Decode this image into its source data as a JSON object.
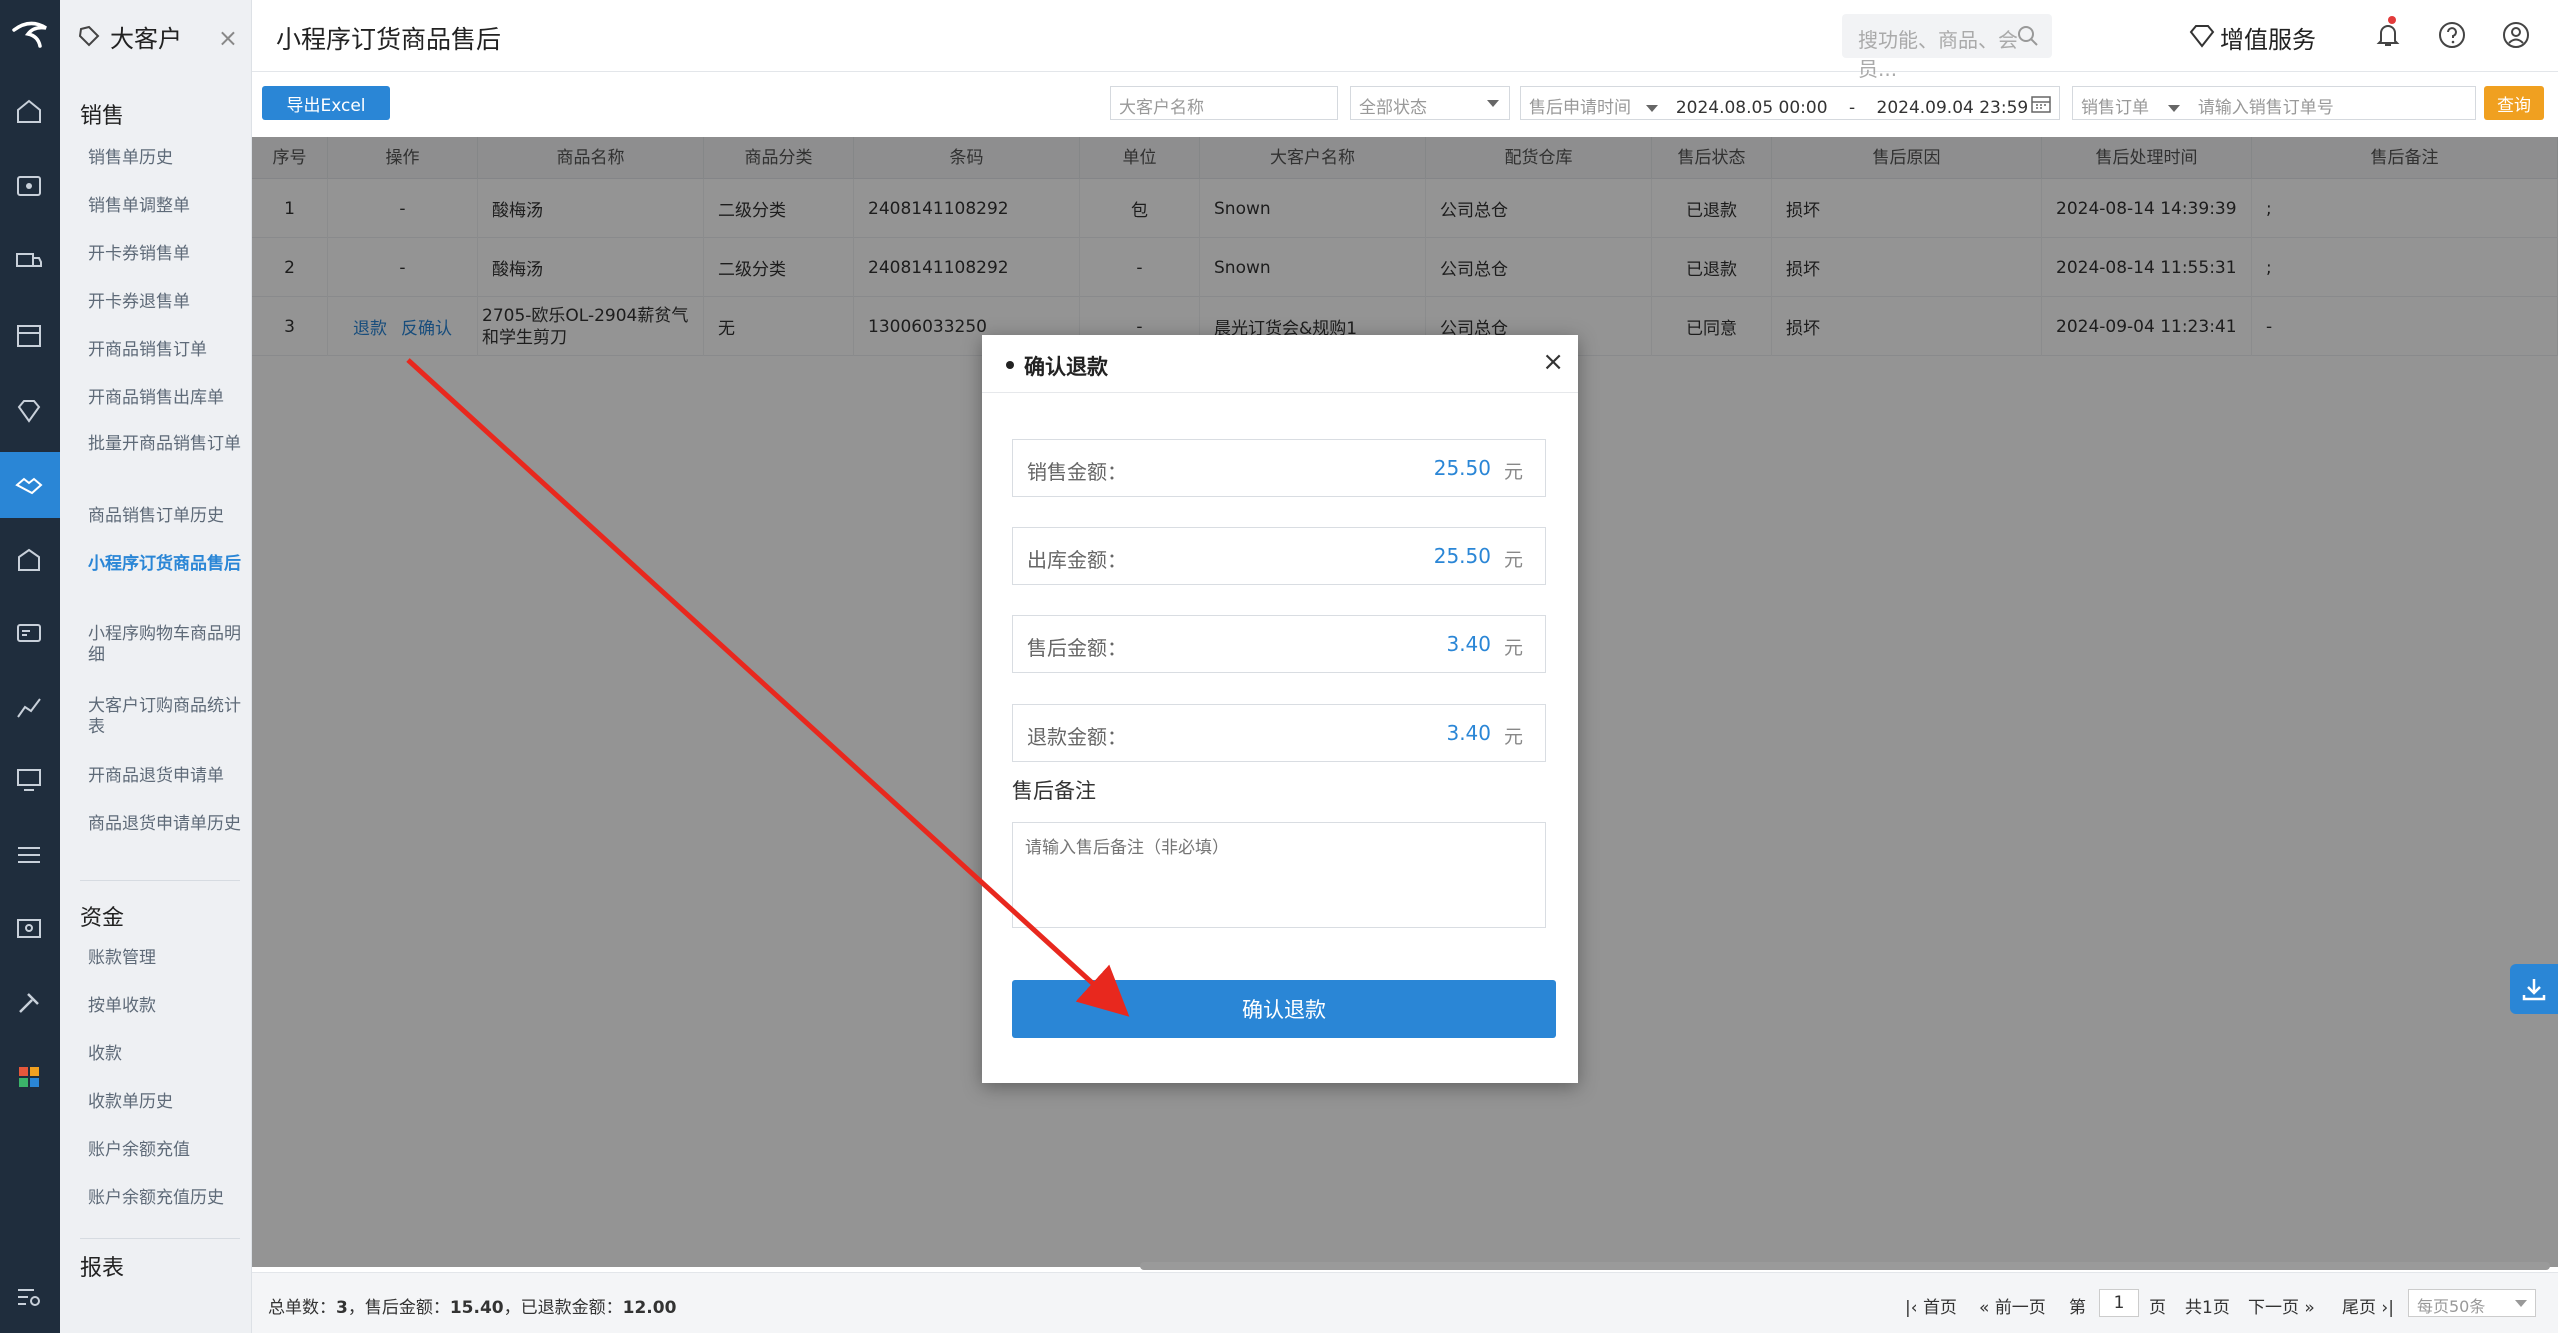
{
  "app": {
    "tab_name": "大客户",
    "page_title": "小程序订货商品售后",
    "search_placeholder": "搜功能、商品、会员...",
    "value_added_service": "增值服务"
  },
  "sidebar": {
    "groups": [
      {
        "label": "销售"
      },
      {
        "label": "资金"
      },
      {
        "label": "报表"
      }
    ],
    "sales_items": [
      {
        "label": "销售单历史"
      },
      {
        "label": "销售单调整单"
      },
      {
        "label": "开卡券销售单"
      },
      {
        "label": "开卡券退售单"
      },
      {
        "label": "开商品销售订单"
      },
      {
        "label": "开商品销售出库单"
      },
      {
        "label": "批量开商品销售订单"
      },
      {
        "label": "商品销售订单历史"
      },
      {
        "label": "小程序订货商品售后"
      },
      {
        "label": "小程序购物车商品明细"
      },
      {
        "label": "大客户订购商品统计表"
      },
      {
        "label": "开商品退货申请单"
      },
      {
        "label": "商品退货申请单历史"
      }
    ],
    "fund_items": [
      {
        "label": "账款管理"
      },
      {
        "label": "按单收款"
      },
      {
        "label": "收款"
      },
      {
        "label": "收款单历史"
      },
      {
        "label": "账户余额充值"
      },
      {
        "label": "账户余额充值历史"
      }
    ]
  },
  "toolbar": {
    "export_label": "导出Excel",
    "customer_placeholder": "大客户名称",
    "status_select": "全部状态",
    "time_type_select": "售后申请时间",
    "date_start": "2024.08.05 00:00",
    "date_sep": "-",
    "date_end": "2024.09.04 23:59",
    "order_type_select": "销售订单",
    "order_no_placeholder": "请输入销售订单号",
    "query_label": "查询"
  },
  "table": {
    "columns": [
      "序号",
      "操作",
      "商品名称",
      "商品分类",
      "条码",
      "单位",
      "大客户名称",
      "配货仓库",
      "售后状态",
      "售后原因",
      "售后处理时间",
      "售后备注"
    ],
    "rows": [
      {
        "no": "1",
        "op": "-",
        "op_links": [],
        "name": "酸梅汤",
        "category": "二级分类",
        "barcode": "2408141108292",
        "unit": "包",
        "customer": "Snown",
        "warehouse": "公司总仓",
        "status": "已退款",
        "reason": "损坏",
        "time": "2024-08-14 14:39:39",
        "remark": ";"
      },
      {
        "no": "2",
        "op": "-",
        "op_links": [],
        "name": "酸梅汤",
        "category": "二级分类",
        "barcode": "2408141108292",
        "unit": "-",
        "customer": "Snown",
        "warehouse": "公司总仓",
        "status": "已退款",
        "reason": "损坏",
        "time": "2024-08-14 11:55:31",
        "remark": ";"
      },
      {
        "no": "3",
        "op": "",
        "op_links": [
          "退款",
          "反确认"
        ],
        "name": "2705-欧乐OL-2904薪贫气和学生剪刀",
        "category": "无",
        "barcode": "13006033250",
        "unit": "-",
        "customer": "晨光订货会&规购1",
        "warehouse": "公司总仓",
        "status": "已同意",
        "reason": "损坏",
        "time": "2024-09-04 11:23:41",
        "remark": "-"
      }
    ]
  },
  "footer": {
    "summary_prefix": "总单数：",
    "total_orders": "3",
    "summary_mid1": "，售后金额：",
    "aftersale_amount": "15.40",
    "summary_mid2": "，已退款金额：",
    "refunded_amount": "12.00",
    "first": "首页",
    "prev": "前一页",
    "page_prefix": "第",
    "current_page": "1",
    "page_suffix": "页",
    "total_pages": "共1页",
    "next": "下一页",
    "last": "尾页",
    "page_size": "每页50条"
  },
  "modal": {
    "title": "确认退款",
    "close": "×",
    "fields": [
      {
        "label": "销售金额：",
        "value": "25.50",
        "unit": "元"
      },
      {
        "label": "出库金额：",
        "value": "25.50",
        "unit": "元"
      },
      {
        "label": "售后金额：",
        "value": "3.40",
        "unit": "元"
      },
      {
        "label": "退款金额：",
        "value": "3.40",
        "unit": "元"
      }
    ],
    "remark_label": "售后备注",
    "remark_placeholder": "请输入售后备注（非必填）",
    "confirm_label": "确认退款"
  },
  "colors": {
    "accent": "#2a86d6",
    "query": "#f0a020",
    "annotation_arrow": "#e8281e"
  }
}
